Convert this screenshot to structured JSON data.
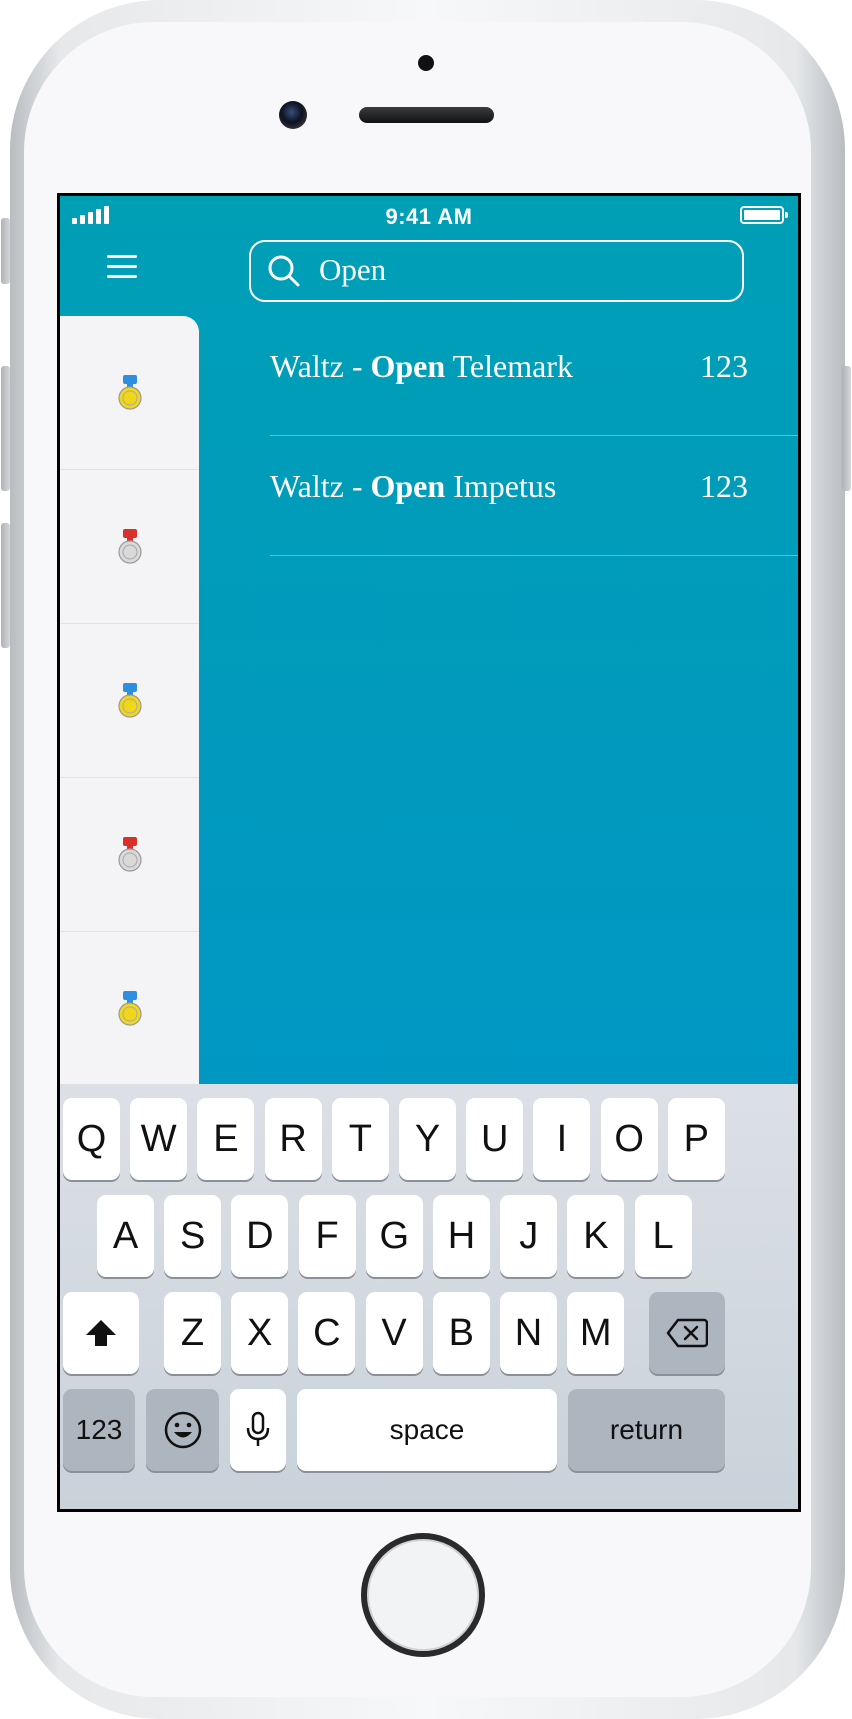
{
  "status_bar": {
    "time": "9:41 AM"
  },
  "search": {
    "query": "Open"
  },
  "side_panel": {
    "items": [
      {
        "medal": "gold-medal-icon",
        "ribbon_color": "#2e8fe0",
        "medal_color": "#f1d71a"
      },
      {
        "medal": "silver-medal-icon",
        "ribbon_color": "#d9302c",
        "medal_color": "#d9d9d9"
      },
      {
        "medal": "gold-medal-icon",
        "ribbon_color": "#2e8fe0",
        "medal_color": "#f1d71a"
      },
      {
        "medal": "silver-medal-icon",
        "ribbon_color": "#d9302c",
        "medal_color": "#d9d9d9"
      },
      {
        "medal": "gold-medal-icon",
        "ribbon_color": "#2e8fe0",
        "medal_color": "#f1d71a"
      }
    ]
  },
  "results": [
    {
      "prefix": "Waltz - ",
      "match": "Open",
      "suffix": " Telemark",
      "count": "123"
    },
    {
      "prefix": "Waltz - ",
      "match": "Open",
      "suffix": " Impetus",
      "count": "123"
    }
  ],
  "keyboard": {
    "row1": [
      "Q",
      "W",
      "E",
      "R",
      "T",
      "Y",
      "U",
      "I",
      "O",
      "P"
    ],
    "row2": [
      "A",
      "S",
      "D",
      "F",
      "G",
      "H",
      "J",
      "K",
      "L"
    ],
    "row3": [
      "Z",
      "X",
      "C",
      "V",
      "B",
      "N",
      "M"
    ],
    "numbers_key": "123",
    "space_key": "space",
    "return_key": "return"
  },
  "colors": {
    "screen_top": "#009fb6",
    "screen_bottom": "#0094cf",
    "panel": "#f4f4f6"
  }
}
